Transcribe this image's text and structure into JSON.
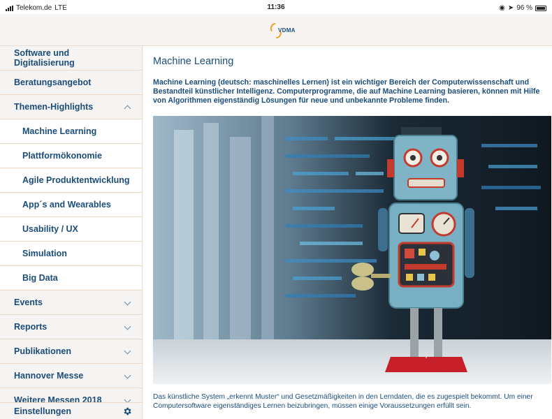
{
  "status": {
    "carrier": "Telekom.de",
    "network": "LTE",
    "time": "11:36",
    "battery": "96 %"
  },
  "header": {
    "logo_text": "VDMA"
  },
  "sidebar": {
    "items": [
      {
        "label": "Software und Digitalisierung"
      },
      {
        "label": "Beratungsangebot"
      },
      {
        "label": "Themen-Highlights"
      },
      {
        "label": "Machine Learning"
      },
      {
        "label": "Plattformökonomie"
      },
      {
        "label": "Agile Produktentwicklung"
      },
      {
        "label": "App´s and Wearables"
      },
      {
        "label": "Usability / UX"
      },
      {
        "label": "Simulation"
      },
      {
        "label": "Big Data"
      },
      {
        "label": "Events"
      },
      {
        "label": "Reports"
      },
      {
        "label": "Publikationen"
      },
      {
        "label": "Hannover Messe"
      },
      {
        "label": "Weitere Messen 2018"
      }
    ],
    "settings_label": "Einstellungen"
  },
  "main": {
    "title": "Machine Learning",
    "intro": "Machine Learning (deutsch: maschinelles Lernen) ist ein wichtiger Bereich der Computerwissenschaft und Bestandteil künstlicher Intelligenz. Computerprogramme, die auf Machine Learning basieren, können mit Hilfe von Algorithmen eigenständig Lösungen für neue und unbekannte Probleme finden.",
    "outro": "Das künstliche System „erkennt Muster“ und Gesetzmäßigkeiten in den Lerndaten, die es zugespielt bekommt. Um einer Computersoftware eigenständiges Lernen beizubringen, müssen einige Voraussetzungen erfüllt sein."
  },
  "colors": {
    "brand_blue": "#1c4d7a",
    "accent_orange": "#f0a020",
    "divider": "#ead9c4"
  }
}
